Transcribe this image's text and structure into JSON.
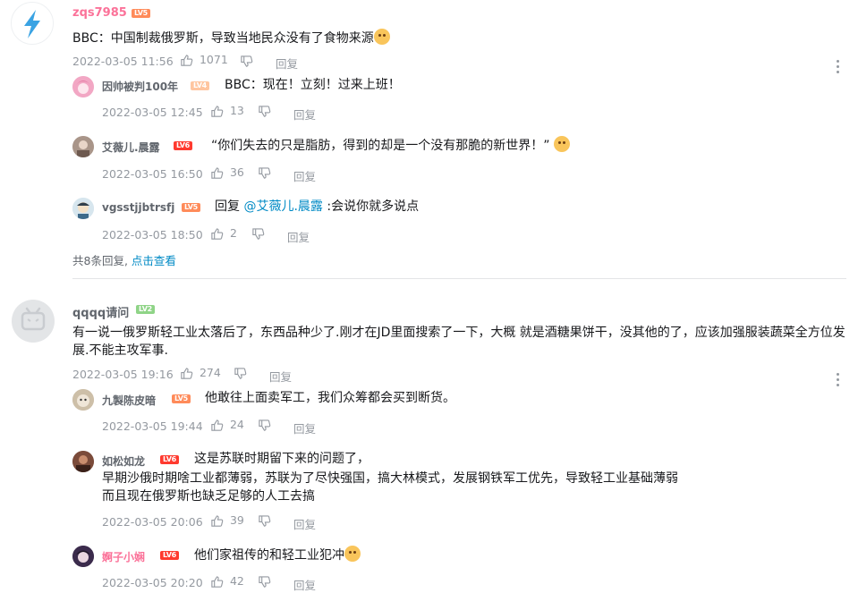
{
  "c1": {
    "user": "zqs7985",
    "level": "LV5",
    "text": "BBC：中国制裁俄罗斯，导致当地民众没有了食物来源",
    "time": "2022-03-05 11:56",
    "likes": "1071",
    "reply_label": "回复",
    "replies": [
      {
        "user": "因帅被判100年",
        "level": "LV4",
        "text": "BBC：现在！立刻！过来上班！",
        "time": "2022-03-05 12:45",
        "likes": "13",
        "reply_label": "回复"
      },
      {
        "user": "艾薇儿.晨露",
        "level": "LV6",
        "text": "“你们失去的只是脂肪，得到的却是一个没有那脆的新世界！”",
        "time": "2022-03-05 16:50",
        "likes": "36",
        "reply_label": "回复"
      },
      {
        "user": "vgsstjjbtrsfj",
        "level": "LV5",
        "prefix": "回复",
        "mention": "@艾薇儿.晨露",
        "text": ":会说你就多说点",
        "time": "2022-03-05 18:50",
        "likes": "2",
        "reply_label": "回复"
      }
    ],
    "summary_text": "共8条回复,",
    "summary_link": "点击查看"
  },
  "c2": {
    "user": "qqqq请问",
    "level": "LV2",
    "text": "有一说一俄罗斯轻工业太落后了，东西品种少了.刚才在JD里面搜索了一下，大概 就是酒糖果饼干，没其他的了，应该加强服装蔬菜全方位发展.不能主攻军事.",
    "time": "2022-03-05 19:16",
    "likes": "274",
    "reply_label": "回复",
    "replies": [
      {
        "user": "九製陈皮暗",
        "level": "LV5",
        "text": "他敢往上面卖军工，我们众筹都会买到断货。",
        "time": "2022-03-05 19:44",
        "likes": "24",
        "reply_label": "回复"
      },
      {
        "user": "如松如龙",
        "level": "LV6",
        "text": "这是苏联时期留下来的问题了，",
        "line2": "早期沙俄时期啥工业都薄弱，苏联为了尽快强国，搞大林模式，发展钢铁军工优先，导致轻工业基础薄弱",
        "line3": "而且现在俄罗斯也缺乏足够的人工去搞",
        "time": "2022-03-05 20:06",
        "likes": "39",
        "reply_label": "回复"
      },
      {
        "user": "婀子小娴",
        "level": "LV6",
        "text": "他们家祖传的和轻工业犯冲",
        "time": "2022-03-05 20:20",
        "likes": "42",
        "reply_label": "回复"
      }
    ]
  },
  "colors": {
    "link": "#008ac5",
    "meta": "#9499a0",
    "pink": "#fb7299"
  }
}
